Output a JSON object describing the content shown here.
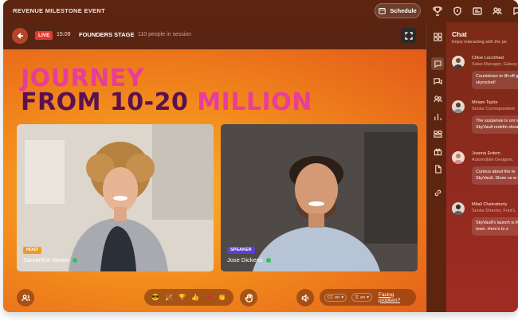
{
  "topbar": {
    "event_title": "REVENUE MILESTONE EVENT",
    "schedule_label": "Schedule",
    "icons": [
      "trophy-icon",
      "shield-icon",
      "card-icon",
      "people-icon",
      "chat-bubble-icon"
    ]
  },
  "stagebar": {
    "live_label": "LIVE",
    "timer": "15:09",
    "stage_name": "FOUNDERS STAGE",
    "session_count": "110 people in session"
  },
  "stage": {
    "title_line1": "JOURNEY",
    "title_line2_prefix": "FROM 10-20 ",
    "title_line2_highlight": "MILLION",
    "speakers": [
      {
        "role": "HOST",
        "name": "Samantha Moore"
      },
      {
        "role": "SPEAKER",
        "name": "Jose Dickens"
      }
    ]
  },
  "controls": {
    "reactions": [
      "😎",
      "🎉",
      "🏆",
      "👍",
      "❤",
      "👏"
    ],
    "caption_lang": "en",
    "audio_lang": "en",
    "facing_problem": "Facing problem?"
  },
  "chat": {
    "title": "Chat",
    "subtitle": "Enjoy interacting with the pe",
    "messages": [
      {
        "name": "Chloe Locchhed",
        "role": "Sales Manager, Galaxy",
        "text": "Countdown to lift-off going to skyrocket!"
      },
      {
        "name": "Miriam Taylor",
        "role": "Senior Correspondent",
        "text": "The suspense is unr see SkyVault redefin storage"
      },
      {
        "name": "Joanna Erdem",
        "role": "Automobile Designer,",
        "text": "Curious about the te SkyVault. Show us w got!"
      },
      {
        "name": "Mitali Chakraborty",
        "role": "Senior Director, Ford L",
        "text": "SkyVault's launch is the town. Here's to s"
      }
    ]
  },
  "colors": {
    "accent": "#e23a2f",
    "title_pink": "#e83d9c",
    "title_plum": "#5b1150",
    "host_badge": "#f29a1d",
    "speaker_badge": "#5b3fd6"
  }
}
